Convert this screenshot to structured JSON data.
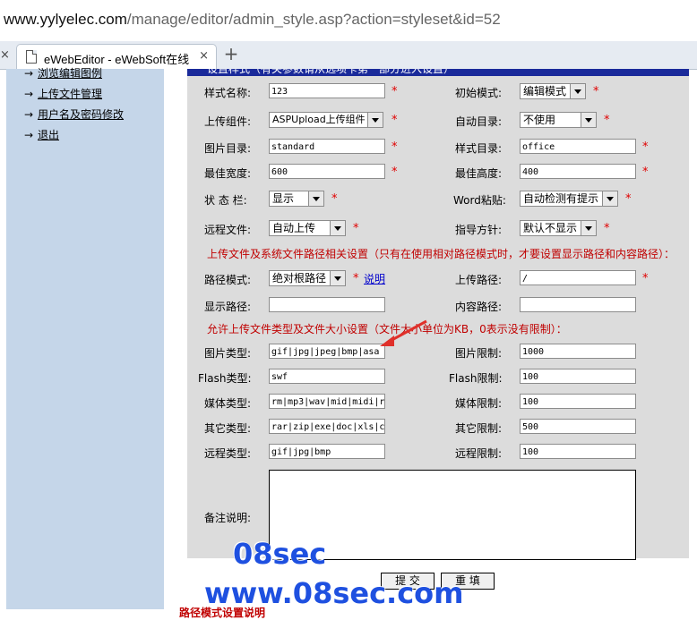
{
  "browser": {
    "url_host": "www.yylyelec.com",
    "url_path": "/manage/editor/admin_style.asp?action=styleset&id=52",
    "tab_title": "eWebEditor - eWebSoft在线",
    "tab_left_close": "×",
    "tab_close": "×",
    "new_tab": "+"
  },
  "sidebar": {
    "items": [
      {
        "label": "浏览编辑图例"
      },
      {
        "label": "上传文件管理"
      },
      {
        "label": "用户名及密码修改"
      },
      {
        "label": "退出"
      }
    ],
    "arrow": "→"
  },
  "panel": {
    "header_text": "设置样式（有关参数请从选项卡第一部分进入设置）",
    "fields": {
      "style_name": {
        "label": "样式名称:",
        "value": "123"
      },
      "init_mode": {
        "label": "初始模式:",
        "value": "编辑模式"
      },
      "upload_component": {
        "label": "上传组件:",
        "value": "ASPUpload上传组件"
      },
      "auto_dir": {
        "label": "自动目录:",
        "value": "不使用"
      },
      "image_dir": {
        "label": "图片目录:",
        "value": "standard"
      },
      "style_dir": {
        "label": "样式目录:",
        "value": "office"
      },
      "max_width": {
        "label": "最佳宽度:",
        "value": "600"
      },
      "max_height": {
        "label": "最佳高度:",
        "value": "400"
      },
      "status_bar": {
        "label": "状 态 栏:",
        "value": "显示"
      },
      "word_paste": {
        "label": "Word粘贴:",
        "value": "自动检测有提示"
      },
      "remote_file": {
        "label": "远程文件:",
        "value": "自动上传"
      },
      "guide_method": {
        "label": "指导方针:",
        "value": "默认不显示"
      },
      "path_mode": {
        "label": "路径模式:",
        "value": "绝对根路径",
        "help": "说明"
      },
      "upload_path": {
        "label": "上传路径:",
        "value": "/"
      },
      "display_path": {
        "label": "显示路径:",
        "value": ""
      },
      "content_path": {
        "label": "内容路径:",
        "value": ""
      },
      "image_types": {
        "label": "图片类型:",
        "value": "gif|jpg|jpeg|bmp|asa"
      },
      "image_limit": {
        "label": "图片限制:",
        "value": "1000"
      },
      "flash_types": {
        "label": "Flash类型:",
        "value": "swf"
      },
      "flash_limit": {
        "label": "Flash限制:",
        "value": "100"
      },
      "media_types": {
        "label": "媒体类型:",
        "value": "rm|mp3|wav|mid|midi|r"
      },
      "media_limit": {
        "label": "媒体限制:",
        "value": "100"
      },
      "other_types": {
        "label": "其它类型:",
        "value": "rar|zip|exe|doc|xls|c"
      },
      "other_limit": {
        "label": "其它限制:",
        "value": "500"
      },
      "remote_types": {
        "label": "远程类型:",
        "value": "gif|jpg|bmp"
      },
      "remote_limit": {
        "label": "远程限制:",
        "value": "100"
      },
      "remark": {
        "label": "备注说明:",
        "value": ""
      }
    },
    "required_mark": "*",
    "notice_path": "上传文件及系统文件路径相关设置（只有在使用相对路径模式时，才要设置显示路径和内容路径）：",
    "notice_types": "允许上传文件类型及文件大小设置（文件大小单位为KB，0表示没有限制）：",
    "submit_label": "提 交",
    "reset_label": "重 填"
  },
  "footer_text": "路径模式设置说明",
  "watermark": {
    "line1": "08sec",
    "line2": "www.08sec.com"
  },
  "colors": {
    "sidebar_bg": "#c5d6e9",
    "panel_bg": "#dcdcdc",
    "panel_header": "#1a2a9a",
    "notice_red": "#c00000",
    "watermark_blue": "#1e50e0",
    "arrow_red": "#e0302a"
  }
}
